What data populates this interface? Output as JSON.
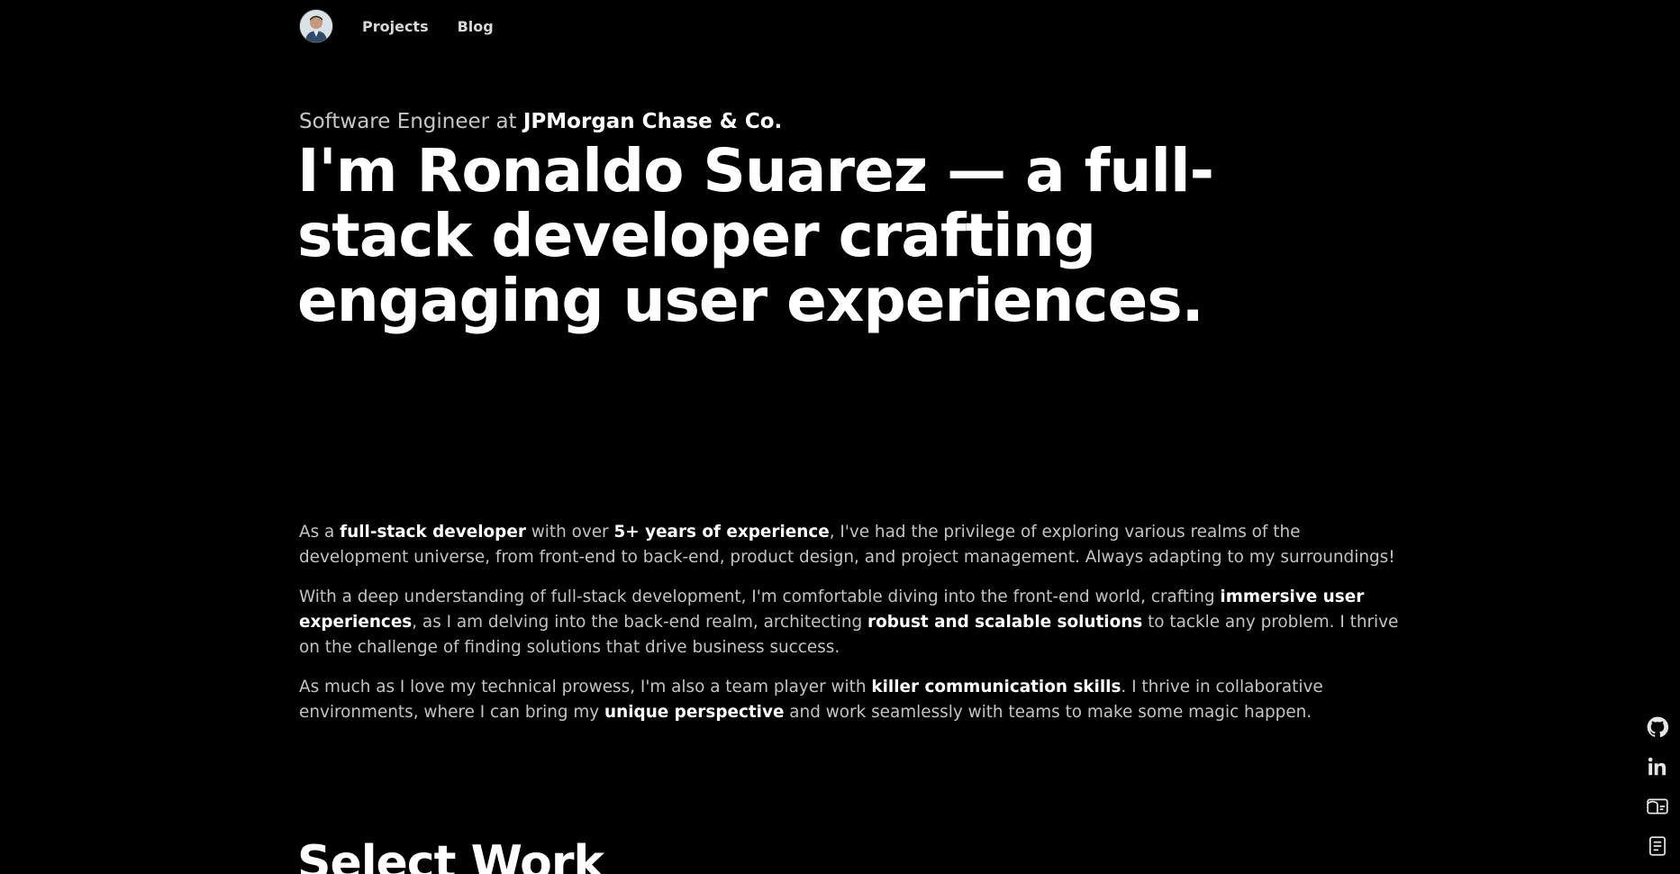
{
  "nav": {
    "links": [
      {
        "label": "Projects"
      },
      {
        "label": "Blog"
      }
    ]
  },
  "hero": {
    "subtitle_prefix": "Software Engineer at ",
    "subtitle_company": "JPMorgan Chase & Co.",
    "headline": "I'm Ronaldo Suarez — a full-stack developer crafting engaging user experiences."
  },
  "about": {
    "p1": {
      "t1": "As a ",
      "b1": "full-stack developer",
      "t2": " with over ",
      "b2": "5+ years of experience",
      "t3": ", I've had the privilege of exploring various realms of the development universe, from front-end to back-end, product design, and project management. Always adapting to my surroundings!"
    },
    "p2": {
      "t1": "With a deep understanding of full-stack development, I'm comfortable diving into the front-end world, crafting ",
      "b1": "immersive user experiences",
      "t2": ", as I am delving into the back-end realm, architecting ",
      "b2": "robust and scalable solutions",
      "t3": " to tackle any problem. I thrive on the challenge of finding solutions that drive business success."
    },
    "p3": {
      "t1": "As much as I love my technical prowess, I'm also a team player with ",
      "b1": "killer communication skills",
      "t2": ". I thrive in collaborative environments, where I can bring my ",
      "b2": "unique perspective",
      "t3": " and work seamlessly with teams to make some magic happen."
    }
  },
  "section": {
    "title": "Select Work"
  },
  "socials": [
    {
      "icon": "github-icon"
    },
    {
      "icon": "linkedin-icon"
    },
    {
      "icon": "id-card-icon"
    },
    {
      "icon": "document-icon"
    }
  ],
  "colors": {
    "background": "#000000",
    "text_primary": "#ffffff",
    "text_secondary": "#c4c4c4"
  }
}
